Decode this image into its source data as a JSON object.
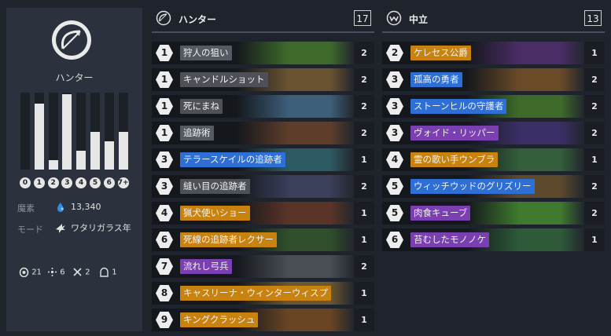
{
  "colors": {
    "free": "#555a62",
    "common": "#4d5057",
    "rare": "#2e6fd6",
    "epic": "#7a3fb0",
    "legendary": "#c7820f"
  },
  "sidebar": {
    "class_icon": "bow-arrow-icon",
    "class_name": "ハンター",
    "mana_curve": [
      {
        "label": "0",
        "value": 0
      },
      {
        "label": "1",
        "value": 7
      },
      {
        "label": "2",
        "value": 1
      },
      {
        "label": "3",
        "value": 8
      },
      {
        "label": "4",
        "value": 2
      },
      {
        "label": "5",
        "value": 4
      },
      {
        "label": "6",
        "value": 3
      },
      {
        "label": "7+",
        "value": 4
      }
    ],
    "dust_label": "魔素",
    "dust_icon": "dust-icon",
    "dust_value": "13,340",
    "mode_label": "モード",
    "mode_icon": "raven-icon",
    "mode_value": "ワタリガラス年",
    "types": [
      {
        "icon": "minion-icon",
        "value": "21"
      },
      {
        "icon": "spell-icon",
        "value": "6"
      },
      {
        "icon": "weapon-icon",
        "value": "2"
      },
      {
        "icon": "hero-icon",
        "value": "1"
      }
    ]
  },
  "hunter": {
    "icon": "hunter-class-icon",
    "title": "ハンター",
    "count": "17",
    "cards": [
      {
        "cost": "1",
        "name": "狩人の狙い",
        "rarity": "free",
        "qty": "2",
        "art": "#3e6b2a"
      },
      {
        "cost": "1",
        "name": "キャンドルショット",
        "rarity": "common",
        "qty": "2",
        "art": "#6a5330"
      },
      {
        "cost": "1",
        "name": "死にまね",
        "rarity": "common",
        "qty": "2",
        "art": "#3d5f7a"
      },
      {
        "cost": "1",
        "name": "追跡術",
        "rarity": "free",
        "qty": "2",
        "art": "#5e3e2a"
      },
      {
        "cost": "3",
        "name": "テラースケイルの追跡者",
        "rarity": "rare",
        "qty": "1",
        "art": "#2d5b63"
      },
      {
        "cost": "3",
        "name": "縫い目の追跡者",
        "rarity": "common",
        "qty": "2",
        "art": "#3a3f5a"
      },
      {
        "cost": "4",
        "name": "猟犬使いショー",
        "rarity": "legendary",
        "qty": "1",
        "art": "#5b3428"
      },
      {
        "cost": "6",
        "name": "死線の追跡者レクサー",
        "rarity": "legendary",
        "qty": "1",
        "art": "#2f4e2a"
      },
      {
        "cost": "7",
        "name": "流れし弓兵",
        "rarity": "epic",
        "qty": "2",
        "art": "#4a4f55"
      },
      {
        "cost": "8",
        "name": "キャスリーナ・ウィンターウィスプ",
        "rarity": "legendary",
        "qty": "1",
        "art": "#6b5730"
      },
      {
        "cost": "9",
        "name": "キングクラッシュ",
        "rarity": "legendary",
        "qty": "1",
        "art": "#6a4524"
      }
    ]
  },
  "neutral": {
    "icon": "neutral-class-icon",
    "title": "中立",
    "count": "13",
    "cards": [
      {
        "cost": "2",
        "name": "ケレセス公爵",
        "rarity": "legendary",
        "qty": "1",
        "art": "#4a2d66"
      },
      {
        "cost": "3",
        "name": "孤高の勇者",
        "rarity": "rare",
        "qty": "2",
        "art": "#6b4a28"
      },
      {
        "cost": "3",
        "name": "ストーンヒルの守護者",
        "rarity": "rare",
        "qty": "2",
        "art": "#3e6b2a"
      },
      {
        "cost": "3",
        "name": "ヴォイド・リッパー",
        "rarity": "epic",
        "qty": "2",
        "art": "#3a2f66"
      },
      {
        "cost": "4",
        "name": "霊の歌い手ウンブラ",
        "rarity": "legendary",
        "qty": "1",
        "art": "#335f3a"
      },
      {
        "cost": "5",
        "name": "ウィッチウッドのグリズリー",
        "rarity": "rare",
        "qty": "2",
        "art": "#5d4a2c"
      },
      {
        "cost": "5",
        "name": "肉食キューブ",
        "rarity": "epic",
        "qty": "2",
        "art": "#3f7a2e"
      },
      {
        "cost": "6",
        "name": "苔むしたモノノケ",
        "rarity": "epic",
        "qty": "1",
        "art": "#2e5a3a"
      }
    ]
  }
}
